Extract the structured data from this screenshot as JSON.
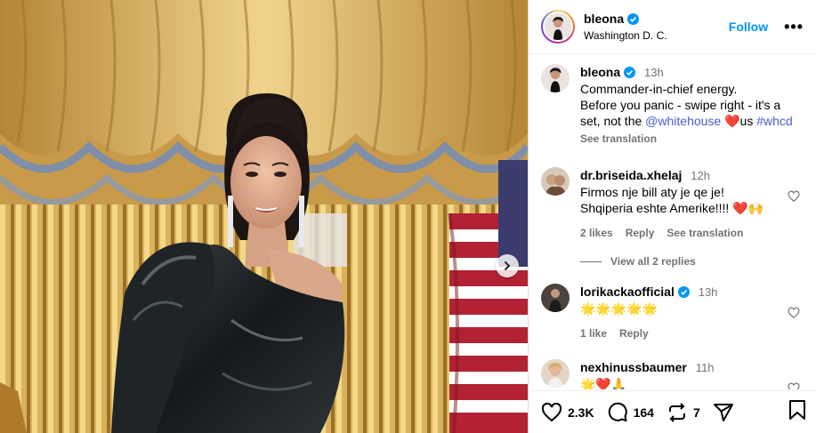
{
  "post": {
    "author": "bleona",
    "location": "Washington D. C.",
    "follow_label": "Follow",
    "more_label": "•••",
    "colors": {
      "accent": "#0095f6",
      "muted": "#737373",
      "link": "#00376b",
      "heart_red": "#ed4956"
    }
  },
  "caption": {
    "username": "bleona",
    "time": "13h",
    "line1": "Commander-in-chief energy.",
    "line2": "Before you panic - swipe right - it's a",
    "line3_a": "set, not the ",
    "mention": "@whitehouse",
    "emoji": "❤️",
    "line3_b": "us ",
    "hashtag": "#whcd",
    "see_translation": "See translation"
  },
  "comments": [
    {
      "username": "dr.briseida.xhelaj",
      "time": "12h",
      "line1": "Firmos nje bill aty je qe je!",
      "line2": "Shqiperia eshte Amerike!!!! ",
      "emoji": "❤️🙌",
      "likes": "2 likes",
      "reply": "Reply",
      "see_translation": "See translation",
      "view_replies": "View all 2 replies"
    },
    {
      "username": "lorikackaofficial",
      "verified": true,
      "time": "13h",
      "text": "🌟🌟🌟🌟🌟",
      "likes": "1 like",
      "reply": "Reply"
    },
    {
      "username": "nexhinussbaumer",
      "time": "11h",
      "text": "🌟❤️🙏"
    }
  ],
  "actions": {
    "likes": "2.3K",
    "comments": "164",
    "reposts": "7"
  },
  "icons": [
    "verified-badge-icon",
    "heart-icon",
    "comment-icon",
    "repost-icon",
    "share-icon",
    "bookmark-icon",
    "chevron-right-icon"
  ]
}
